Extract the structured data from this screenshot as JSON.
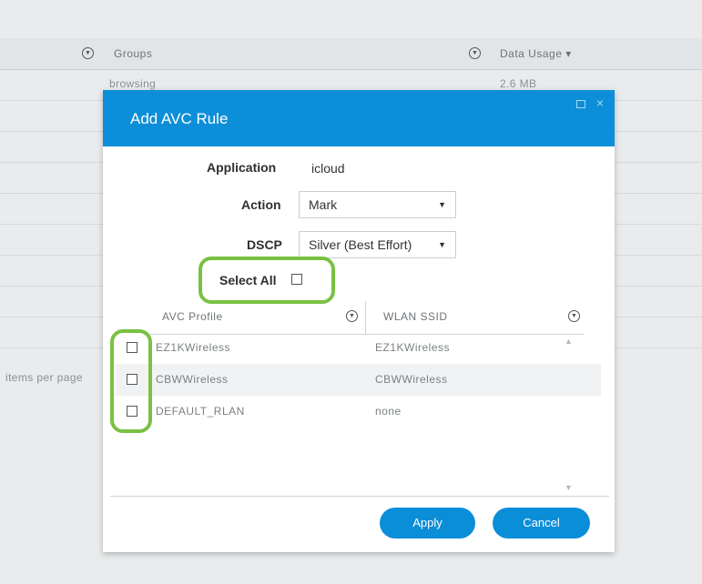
{
  "background": {
    "header": {
      "groups": "Groups",
      "data_usage": "Data Usage ▾"
    },
    "row1": {
      "group": "browsing",
      "usage": "2.6 MB"
    },
    "items_per_page": "items per page"
  },
  "modal": {
    "title": "Add AVC Rule",
    "application_label": "Application",
    "application_value": "icloud",
    "action_label": "Action",
    "action_value": "Mark",
    "dscp_label": "DSCP",
    "dscp_value": "Silver (Best Effort)",
    "select_all_label": "Select All",
    "grid": {
      "columns": [
        "AVC Profile",
        "WLAN SSID"
      ],
      "rows": [
        {
          "profile": "EZ1KWireless",
          "ssid": "EZ1KWireless"
        },
        {
          "profile": "CBWWireless",
          "ssid": "CBWWireless"
        },
        {
          "profile": "DEFAULT_RLAN",
          "ssid": "none"
        }
      ]
    },
    "apply_label": "Apply",
    "cancel_label": "Cancel"
  },
  "colors": {
    "header_blue": "#0c8fd8",
    "highlight_green": "#7ac143",
    "button_blue": "#0b8ed8"
  },
  "icons": [
    "filter-icon",
    "chevron-down-icon",
    "maximize-icon",
    "close-icon",
    "scroll-up-icon",
    "scroll-down-icon"
  ]
}
